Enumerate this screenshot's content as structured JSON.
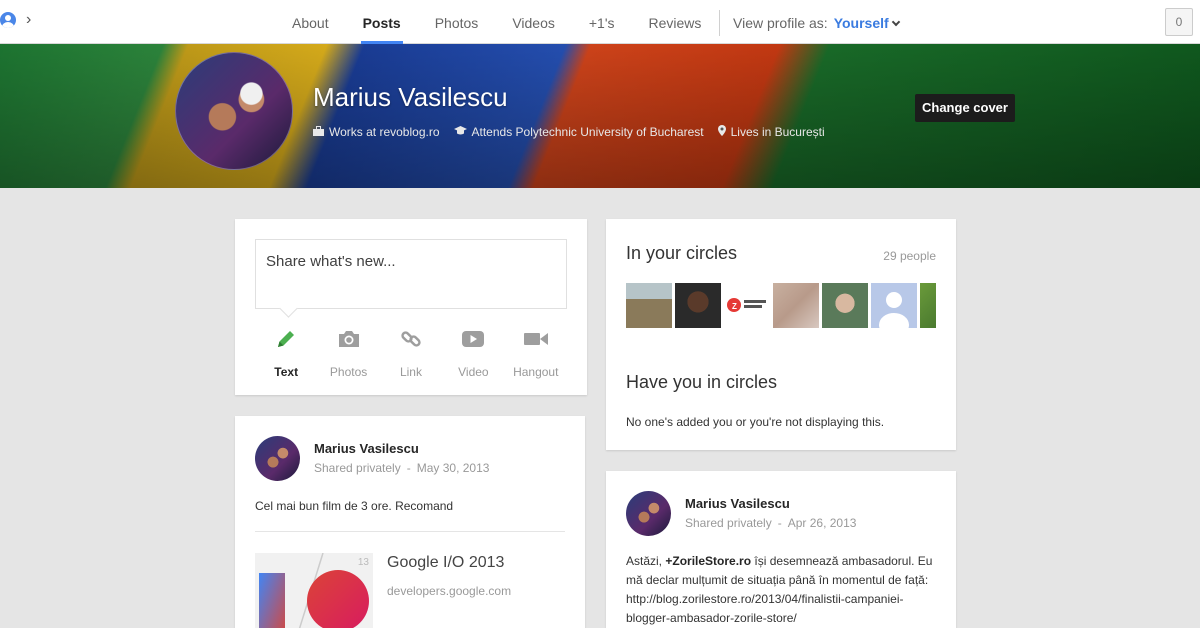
{
  "nav": {
    "tabs": [
      {
        "label": "About"
      },
      {
        "label": "Posts"
      },
      {
        "label": "Photos"
      },
      {
        "label": "Videos"
      },
      {
        "label": "+1's"
      },
      {
        "label": "Reviews"
      }
    ],
    "active_tab": "Posts",
    "view_as_label": "View profile as:",
    "view_as_value": "Yourself",
    "notification_count": "0"
  },
  "profile": {
    "name": "Marius Vasilescu",
    "work": "Works at revoblog.ro",
    "education": "Attends Polytechnic University of Bucharest",
    "location": "Lives in București",
    "change_cover_label": "Change cover"
  },
  "share": {
    "placeholder": "Share what's new...",
    "actions": [
      {
        "label": "Text",
        "icon": "pencil-icon"
      },
      {
        "label": "Photos",
        "icon": "camera-icon"
      },
      {
        "label": "Link",
        "icon": "link-icon"
      },
      {
        "label": "Video",
        "icon": "video-play-icon"
      },
      {
        "label": "Hangout",
        "icon": "video-camera-icon"
      }
    ]
  },
  "circles": {
    "in_title": "In your circles",
    "count": "29 people",
    "have_title": "Have you in circles",
    "have_text": "No one's added you or you're not displaying this.",
    "faces_colors": [
      "#8a7a5a",
      "#2a2a2a",
      "#ffffff",
      "#b89a8a",
      "#5a7a5a",
      "#b8c8e8",
      "#6a9a3a"
    ]
  },
  "posts": [
    {
      "author": "Marius Vasilescu",
      "visibility": "Shared privately",
      "date": "May 30, 2013",
      "text": "Cel mai bun film de 3 ore. Recomand",
      "link_title": "Google I/O 2013",
      "link_domain": "developers.google.com",
      "link_badge": "13"
    },
    {
      "author": "Marius Vasilescu",
      "visibility": "Shared privately",
      "date": "Apr 26, 2013",
      "text_prefix": "Astăzi, ",
      "text_mention": "+ZorileStore.ro",
      "text_rest": " își desemnează ambasadorul. Eu mă declar mulțumit de situația până în momentul de față: http://blog.zorilestore.ro/2013/04/finalistii-campaniei-blogger-ambasador-zorile-store/"
    }
  ]
}
